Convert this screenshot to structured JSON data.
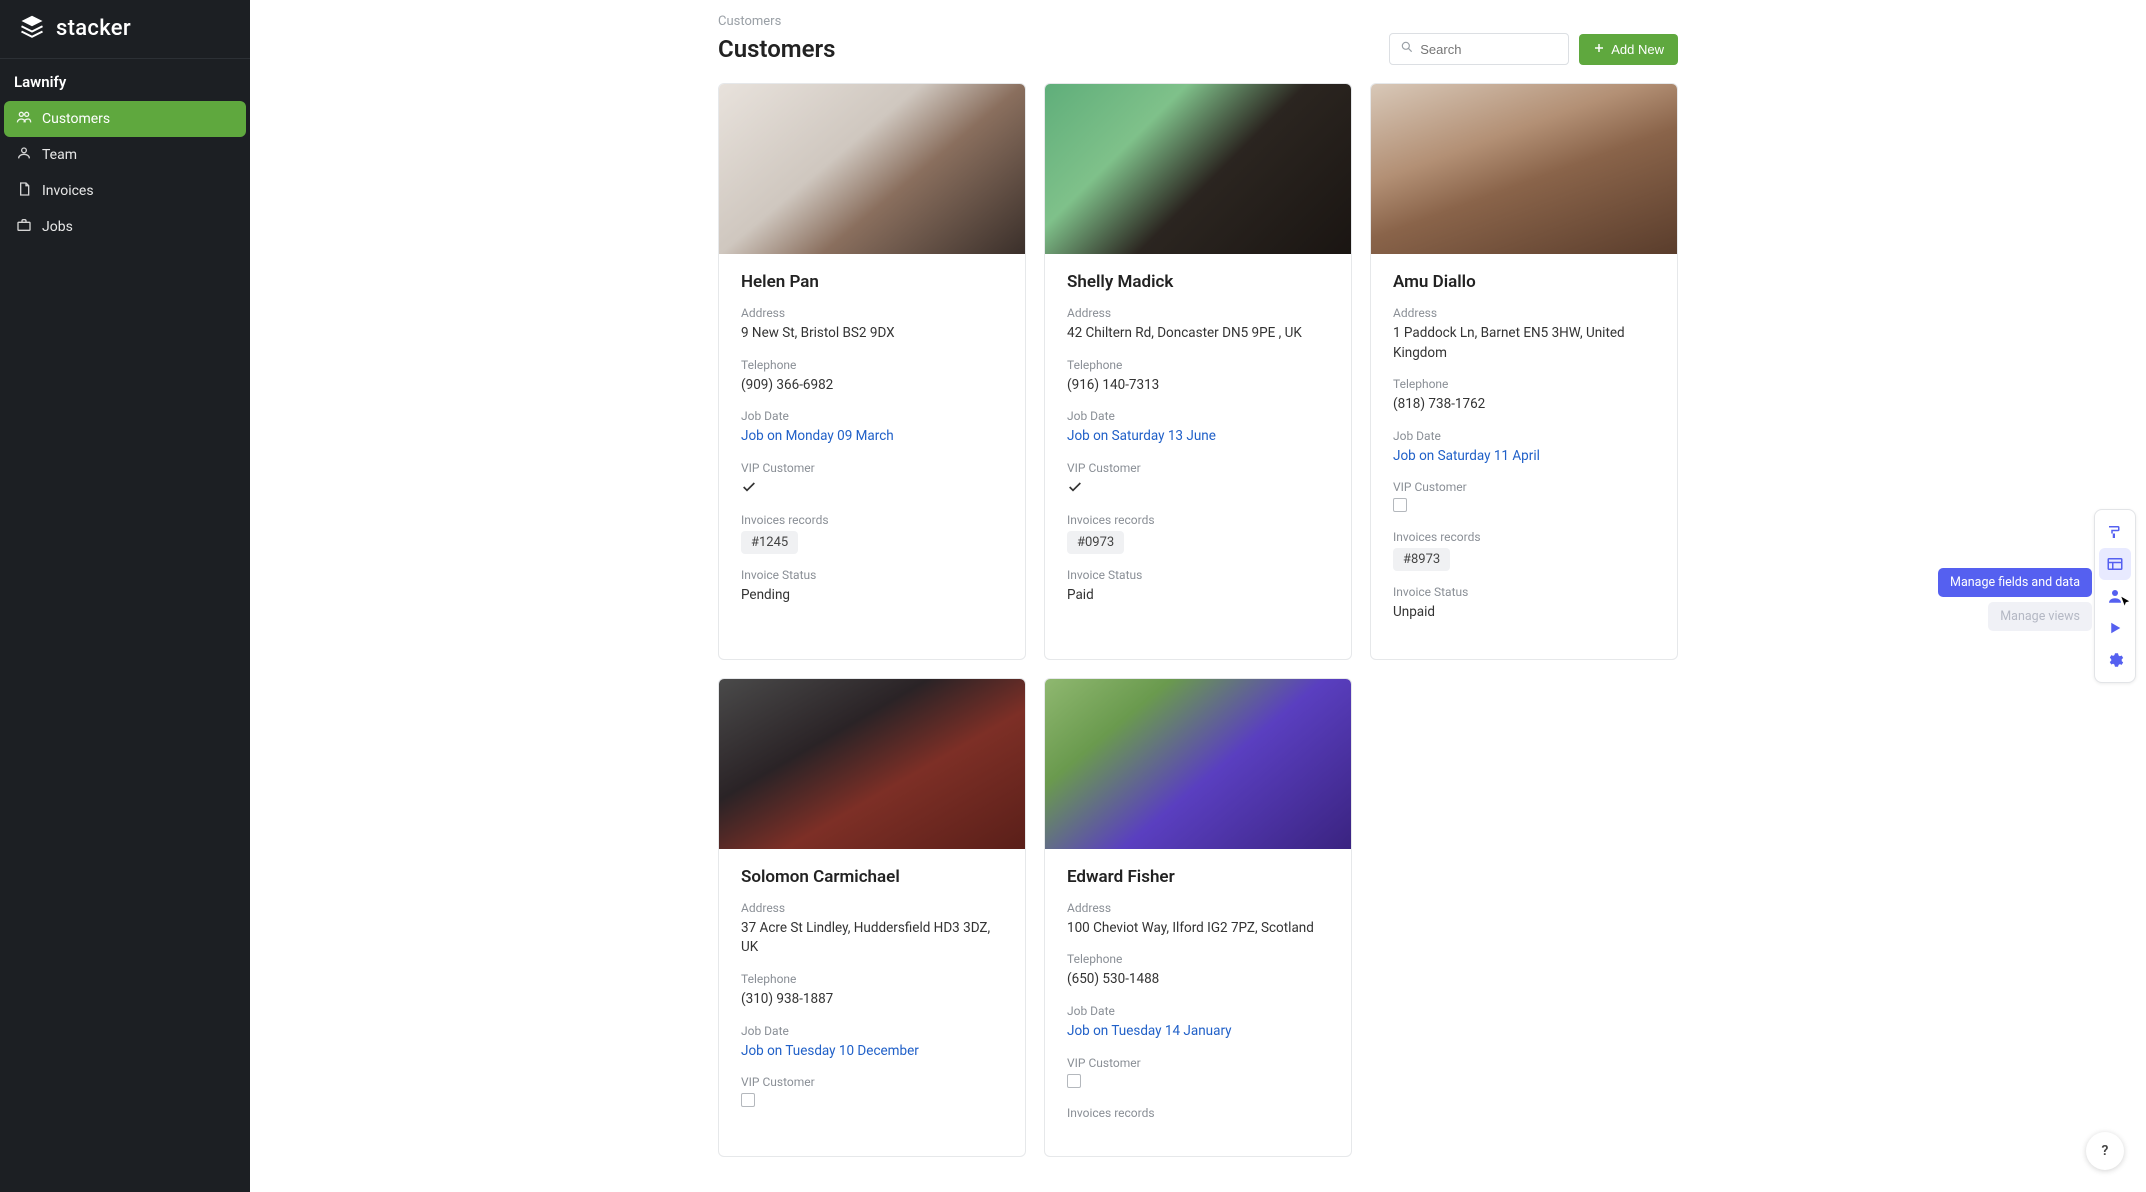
{
  "brand": {
    "name": "stacker"
  },
  "workspace": {
    "name": "Lawnify"
  },
  "sidebar": {
    "items": [
      {
        "label": "Customers",
        "icon": "users"
      },
      {
        "label": "Team",
        "icon": "user"
      },
      {
        "label": "Invoices",
        "icon": "file"
      },
      {
        "label": "Jobs",
        "icon": "briefcase"
      }
    ],
    "activeIndex": 0
  },
  "page": {
    "breadcrumb": "Customers",
    "title": "Customers"
  },
  "search": {
    "placeholder": "Search"
  },
  "actions": {
    "addNew": "Add New"
  },
  "fieldLabels": {
    "address": "Address",
    "telephone": "Telephone",
    "jobDate": "Job Date",
    "vip": "VIP Customer",
    "invoicesRecords": "Invoices records",
    "invoiceStatus": "Invoice Status"
  },
  "customers": [
    {
      "name": "Helen Pan",
      "address": "9 New St, Bristol BS2 9DX",
      "telephone": "(909) 366-6982",
      "jobDate": "Job on Monday 09 March",
      "vip": true,
      "invoice": "#1245",
      "status": "Pending",
      "img": "img1"
    },
    {
      "name": "Shelly Madick",
      "address": "42 Chiltern Rd, Doncaster DN5 9PE , UK",
      "telephone": "(916) 140-7313",
      "jobDate": "Job on Saturday 13 June",
      "vip": true,
      "invoice": "#0973",
      "status": "Paid",
      "img": "img2"
    },
    {
      "name": "Amu Diallo",
      "address": "1 Paddock Ln, Barnet EN5 3HW, United Kingdom",
      "telephone": "(818) 738-1762",
      "jobDate": "Job on Saturday 11 April",
      "vip": false,
      "invoice": "#8973",
      "status": "Unpaid",
      "img": "img3"
    },
    {
      "name": "Solomon Carmichael",
      "address": "37 Acre St Lindley, Huddersfield HD3 3DZ, UK",
      "telephone": "(310) 938-1887",
      "jobDate": "Job on Tuesday 10 December",
      "vip": false,
      "invoice": "",
      "status": "",
      "img": "img4"
    },
    {
      "name": "Edward Fisher",
      "address": "100 Cheviot Way, Ilford IG2 7PZ, Scotland",
      "telephone": "(650) 530-1488",
      "jobDate": "Job on Tuesday 14 January",
      "vip": false,
      "invoice": "",
      "status": "",
      "img": "img5"
    }
  ],
  "floatbar": {
    "tooltipActive": "Manage fields and data",
    "tooltipSecondary": "Manage views"
  },
  "help": {
    "label": "?"
  }
}
